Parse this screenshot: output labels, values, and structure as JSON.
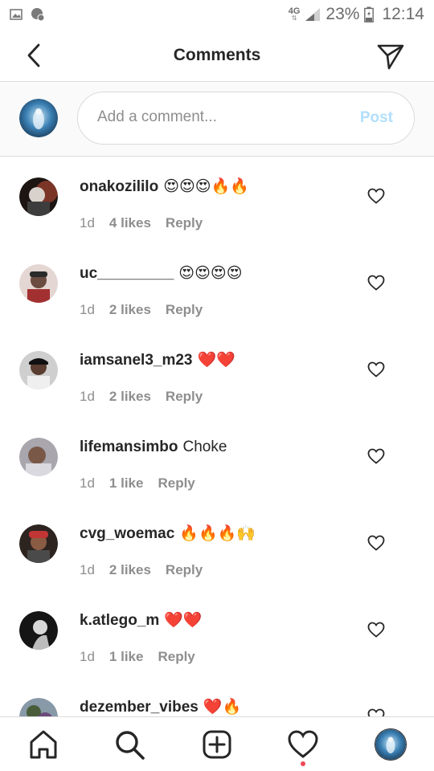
{
  "status_bar": {
    "network": "4G",
    "battery": "23%",
    "time": "12:14"
  },
  "header": {
    "title": "Comments"
  },
  "composer": {
    "placeholder": "Add a comment...",
    "post_label": "Post"
  },
  "comments": [
    {
      "user": "onakozililo",
      "text": "😍😍😍🔥🔥",
      "age": "1d",
      "likes": "4 likes",
      "reply": "Reply",
      "avatar_color": "#3a2a24"
    },
    {
      "user": "uc_________",
      "text": "😍😍😍😍",
      "age": "1d",
      "likes": "2 likes",
      "reply": "Reply",
      "avatar_color": "#7a5a58"
    },
    {
      "user": "iamsanel3_m23",
      "text": "❤️❤️",
      "age": "1d",
      "likes": "2 likes",
      "reply": "Reply",
      "avatar_color": "#4c4c4c"
    },
    {
      "user": "lifemansimbo",
      "text": "Choke",
      "age": "1d",
      "likes": "1 like",
      "reply": "Reply",
      "avatar_color": "#6d6a6e"
    },
    {
      "user": "cvg_woemac",
      "text": "🔥🔥🔥🙌",
      "age": "1d",
      "likes": "2 likes",
      "reply": "Reply",
      "avatar_color": "#5a4238"
    },
    {
      "user": "k.atlego_m",
      "text": "❤️❤️",
      "age": "1d",
      "likes": "1 like",
      "reply": "Reply",
      "avatar_color": "#1f1f1f"
    },
    {
      "user": "dezember_vibes",
      "text": "❤️🔥",
      "age": "",
      "likes": "",
      "reply": "",
      "avatar_color": "#6a7a88"
    }
  ],
  "nav": {
    "items": [
      "home-icon",
      "search-icon",
      "new-post-icon",
      "activity-icon",
      "profile-avatar"
    ],
    "notification_dot_color": "#ed4956"
  },
  "colors": {
    "post_disabled": "#b2dffc",
    "secondary_text": "#8e8e8e",
    "divider": "#dbdbdb"
  }
}
